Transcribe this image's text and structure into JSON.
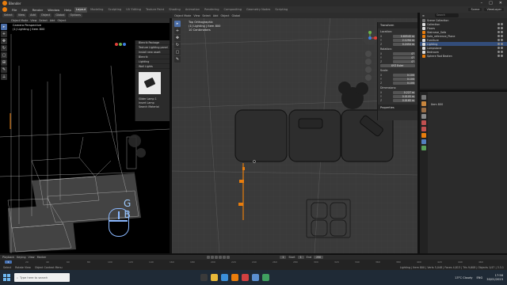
{
  "window": {
    "title": "Blender"
  },
  "menubar": {
    "menus": [
      "File",
      "Edit",
      "Render",
      "Window",
      "Help"
    ],
    "workspaces": [
      "Layout",
      "Modeling",
      "Sculpting",
      "UV Editing",
      "Texture Paint",
      "Shading",
      "Animation",
      "Rendering",
      "Compositing",
      "Geometry Nodes",
      "Scripting"
    ],
    "active_workspace": "Layout",
    "scene": "Scene",
    "view_layer": "ViewLayer"
  },
  "toolbar": {
    "items": [
      "Select",
      "View",
      "Add",
      "Object",
      "Global",
      "Options"
    ]
  },
  "camera_view": {
    "header": [
      "Object Mode",
      "View",
      "Select",
      "Add",
      "Object"
    ],
    "info_line1": "Camera Perspective",
    "info_line2": "(1) Lighting | Item 800",
    "side_panel": {
      "rows": [
        "Blenrik Package",
        "Texture Lighting panel",
        "Install new asset",
        "Blenrik",
        "Lighting",
        "Wall Lights"
      ],
      "bottom": [
        "Slider Lamp 1",
        "Insert Lamp",
        "Search Material"
      ]
    },
    "overlay_letters": [
      "G",
      "B"
    ]
  },
  "ortho_view": {
    "header": [
      "Object Mode",
      "View",
      "Select",
      "Add",
      "Object",
      "Global"
    ],
    "info_line1": "Top Orthographic",
    "info_line2": "(1) Lighting | Item 800",
    "info_line3": "10 Centimeters"
  },
  "n_panel": {
    "title": "Transform",
    "location_label": "Location:",
    "location": [
      [
        "X",
        "0.60545 m"
      ],
      [
        "Y",
        "2.1294 m"
      ],
      [
        "Z",
        "0.2454 m"
      ]
    ],
    "rotation_label": "Rotation:",
    "rotation": [
      [
        "X",
        "0°"
      ],
      [
        "Y",
        "0°"
      ],
      [
        "Z",
        "0°"
      ]
    ],
    "mode": "XYZ Euler",
    "scale_label": "Scale:",
    "scale": [
      [
        "X",
        "0.100"
      ],
      [
        "Y",
        "0.100"
      ],
      [
        "Z",
        "0.100"
      ]
    ],
    "dimensions_label": "Dimensions:",
    "dimensions": [
      [
        "X",
        "0.227 m"
      ],
      [
        "Y",
        "0.0105 m"
      ],
      [
        "Z",
        "0.0165 m"
      ]
    ],
    "properties_label": "Properties"
  },
  "outliner": {
    "title": "Scene Collection",
    "search_placeholder": "Search",
    "items": [
      {
        "name": "Scene Collection",
        "color": "#cfcfcf"
      },
      {
        "name": "Collection",
        "color": "#e0e0e0"
      },
      {
        "name": "Floors",
        "color": "#e0e0e0"
      },
      {
        "name": "Staircase_Sofa",
        "color": "#e0e0e0"
      },
      {
        "name": "Sofa_reference_Plane",
        "color": "#e0e0e0"
      },
      {
        "name": "Furniture",
        "color": "#e0e0e0"
      },
      {
        "name": "Lighting",
        "color": "#e0e0e0"
      },
      {
        "name": "Lampstand",
        "color": "#e0e0e0"
      },
      {
        "name": "Bedroom",
        "color": "#e0e0e0"
      },
      {
        "name": "Sphere Rod Beaten",
        "color": "#e0e0e0"
      }
    ],
    "selected_index": 6
  },
  "properties": {
    "item": "Item 800"
  },
  "timeline": {
    "header": [
      "Playback",
      "Keying",
      "View",
      "Marker"
    ],
    "start_label": "Start",
    "start": "1",
    "end_label": "End",
    "end": "250",
    "current": "1",
    "ruler": [
      "1",
      "20",
      "40",
      "60",
      "80",
      "100",
      "120",
      "140",
      "160",
      "180",
      "200",
      "220",
      "240",
      "260",
      "280",
      "300",
      "320",
      "340",
      "360",
      "380",
      "400",
      "420",
      "440",
      "460"
    ]
  },
  "statusbar": {
    "left": [
      "Select",
      "Rotate View",
      "Object Context Menu"
    ],
    "right": "Lighting | Item 800 | Verts 5,048 | Faces 4,813 | Tris 9,608 | Objects 1/47 | 3.3.1"
  },
  "taskbar": {
    "search_placeholder": "Type here to search",
    "weather": "13°C Cloudy",
    "time": "17:56",
    "date": "30/01/2023",
    "lang": "ENG"
  },
  "colors": {
    "accent": "#e87d0d",
    "selection": "#4772b3",
    "overlay_blue": "#9ecbff"
  }
}
